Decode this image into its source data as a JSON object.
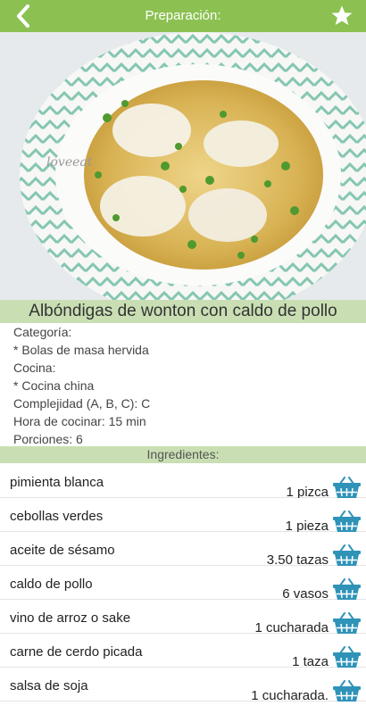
{
  "header": {
    "title": "Preparación:"
  },
  "recipe": {
    "title": "Albóndigas de wonton con caldo de pollo",
    "image_watermark": "loveeat",
    "info": [
      "Categoría:",
      "* Bolas de masa hervida",
      "Cocina:",
      "* Cocina china",
      "Complejidad (A, B, C): C",
      "Hora de cocinar: 15 min",
      "Porciones: 6"
    ]
  },
  "ingredients": {
    "header": "Ingredientes:",
    "items": [
      {
        "name": "pimienta blanca",
        "qty": "1 pizca"
      },
      {
        "name": "cebollas verdes",
        "qty": "1 pieza"
      },
      {
        "name": "aceite de sésamo",
        "qty": "3.50 tazas"
      },
      {
        "name": "caldo de pollo",
        "qty": "6 vasos"
      },
      {
        "name": "vino de arroz o sake",
        "qty": "1 cucharada"
      },
      {
        "name": "carne de cerdo picada",
        "qty": "1 taza"
      },
      {
        "name": "salsa de soja",
        "qty": "1 cucharada."
      }
    ]
  },
  "colors": {
    "accent": "#8cc152",
    "band": "#c9dfb3",
    "basket": "#2f93b8"
  },
  "icons": {
    "back": "chevron-left-icon",
    "favorite": "star-icon",
    "cart": "basket-icon"
  }
}
